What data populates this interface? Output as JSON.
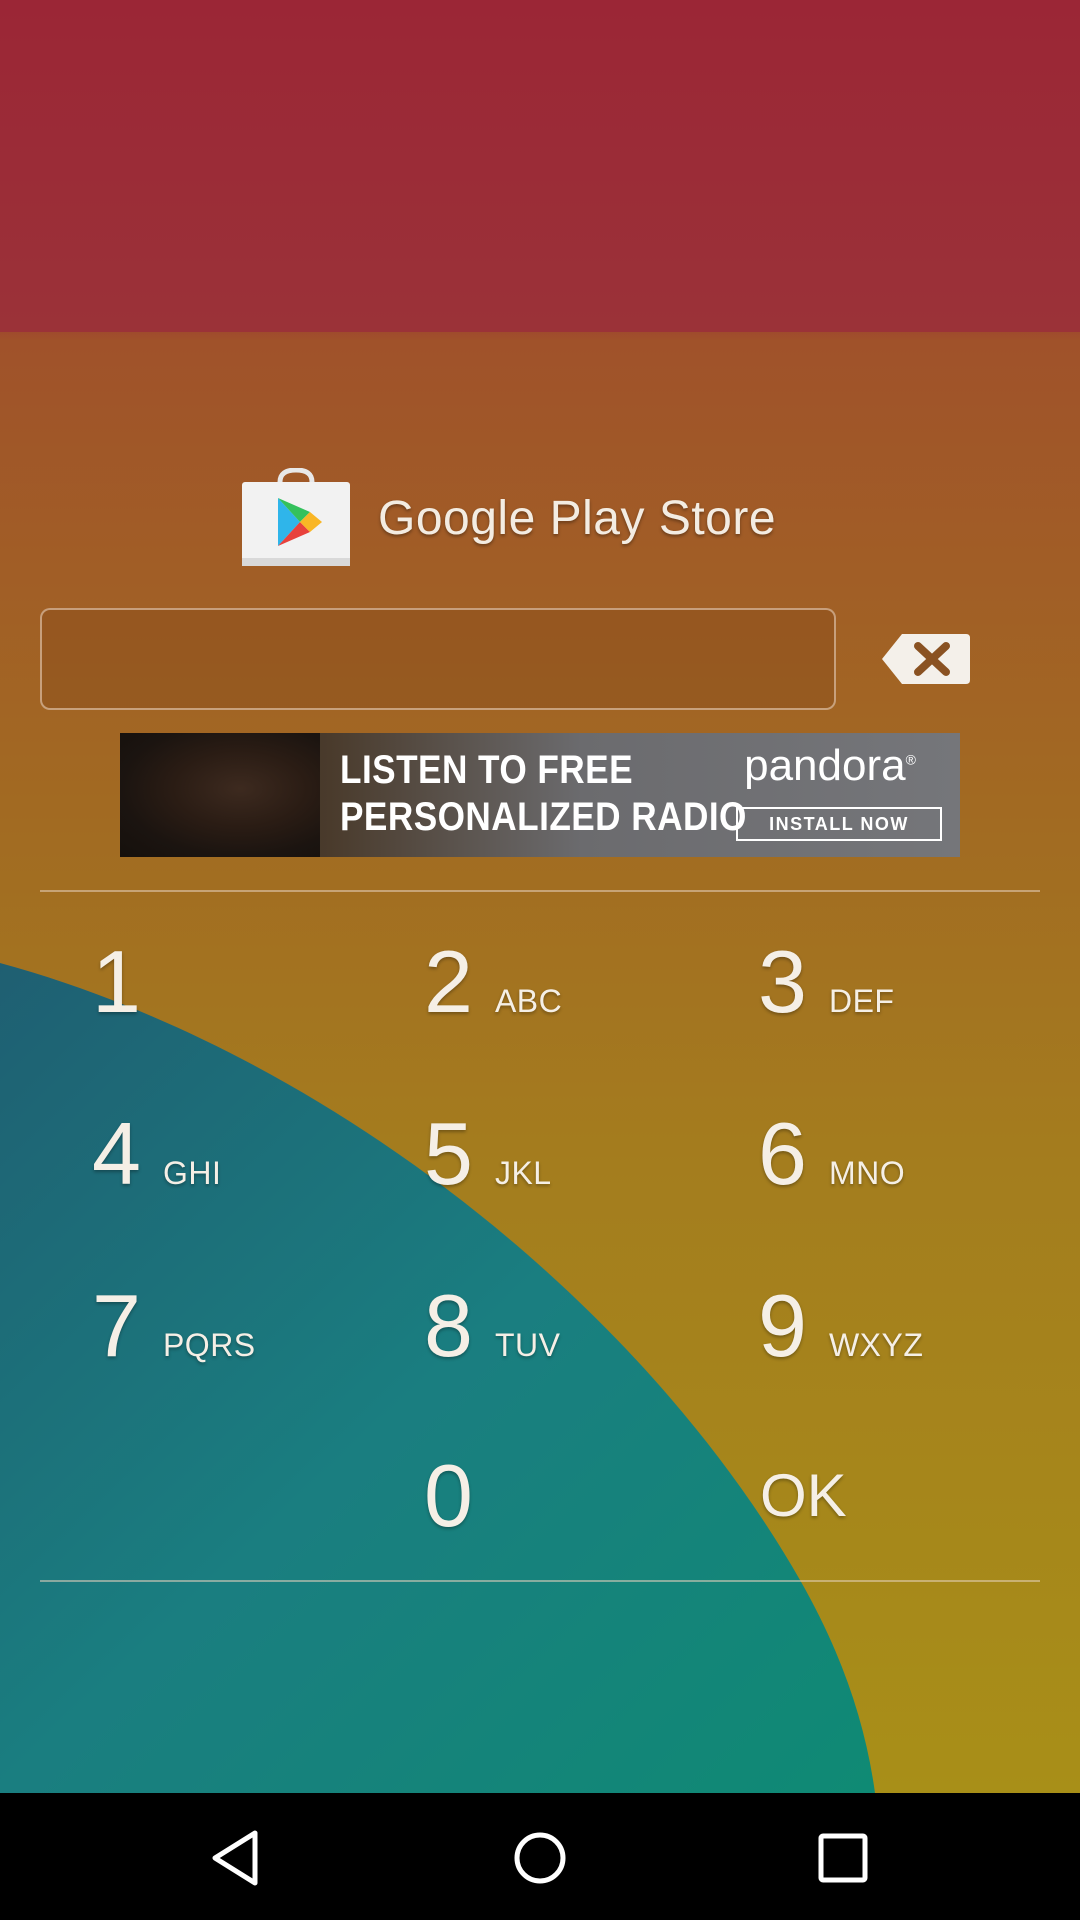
{
  "app": {
    "title": "Google Play Store",
    "icon": "google-play-store-icon"
  },
  "pin_input": {
    "value": "",
    "placeholder": ""
  },
  "ad": {
    "headline_line1": "LISTEN TO FREE",
    "headline_line2": "PERSONALIZED RADIO",
    "brand": "pandora",
    "brand_mark": "®",
    "cta": "INSTALL NOW"
  },
  "keypad": {
    "k1": {
      "digit": "1",
      "letters": ""
    },
    "k2": {
      "digit": "2",
      "letters": "ABC"
    },
    "k3": {
      "digit": "3",
      "letters": "DEF"
    },
    "k4": {
      "digit": "4",
      "letters": "GHI"
    },
    "k5": {
      "digit": "5",
      "letters": "JKL"
    },
    "k6": {
      "digit": "6",
      "letters": "MNO"
    },
    "k7": {
      "digit": "7",
      "letters": "PQRS"
    },
    "k8": {
      "digit": "8",
      "letters": "TUV"
    },
    "k9": {
      "digit": "9",
      "letters": "WXYZ"
    },
    "k0": {
      "digit": "0",
      "letters": ""
    },
    "ok": "OK"
  },
  "navbar": {
    "back": "back-icon",
    "home": "home-icon",
    "recents": "recents-icon"
  },
  "colors": {
    "top_band": "#9b2636",
    "mid": "#a26a22",
    "bottom": "#a88f18",
    "teal": "#158a7c"
  }
}
